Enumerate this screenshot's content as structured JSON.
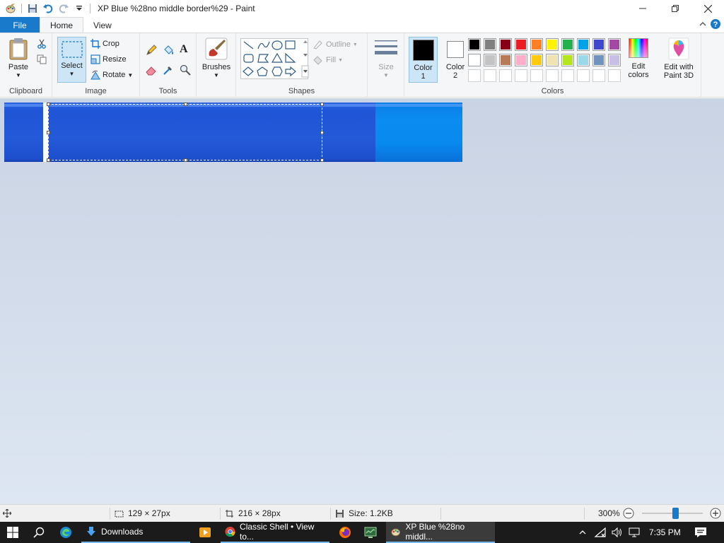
{
  "window": {
    "title": "XP Blue %28no middle border%29 - Paint"
  },
  "menu_tabs": {
    "file": "File",
    "home": "Home",
    "view": "View"
  },
  "ribbon": {
    "clipboard": {
      "label": "Clipboard",
      "paste": "Paste"
    },
    "image": {
      "label": "Image",
      "select": "Select",
      "crop": "Crop",
      "resize": "Resize",
      "rotate": "Rotate"
    },
    "tools": {
      "label": "Tools"
    },
    "brushes": {
      "label": "Brushes"
    },
    "shapes": {
      "label": "Shapes",
      "outline": "Outline",
      "fill": "Fill"
    },
    "size": {
      "label": "Size"
    },
    "colors": {
      "label": "Colors",
      "color1": [
        "Color",
        "1"
      ],
      "color2": [
        "Color",
        "2"
      ],
      "edit_colors": [
        "Edit",
        "colors"
      ],
      "color1_value": "#000000",
      "color2_value": "#ffffff",
      "palette_row1": [
        "#000000",
        "#7f7f7f",
        "#880015",
        "#ed1c24",
        "#ff7f27",
        "#fff200",
        "#22b14c",
        "#00a2e8",
        "#3f48cc",
        "#a349a4"
      ],
      "palette_row2": [
        "#ffffff",
        "#c3c3c3",
        "#b97a57",
        "#ffaec9",
        "#ffc90e",
        "#efe4b0",
        "#b5e61d",
        "#99d9ea",
        "#7092be",
        "#c8bfe7"
      ]
    },
    "paint3d": {
      "label": [
        "Edit with",
        "Paint 3D"
      ]
    }
  },
  "statusbar": {
    "selection_size": "129 × 27px",
    "image_size": "216 × 28px",
    "file_size": "Size: 1.2KB",
    "zoom": "300%",
    "zoom_level_fraction": 0.55
  },
  "taskbar": {
    "downloads": "Downloads",
    "chrome": "Classic Shell • View to...",
    "paint": "XP Blue %28no middl...",
    "time": "7:35 PM"
  }
}
